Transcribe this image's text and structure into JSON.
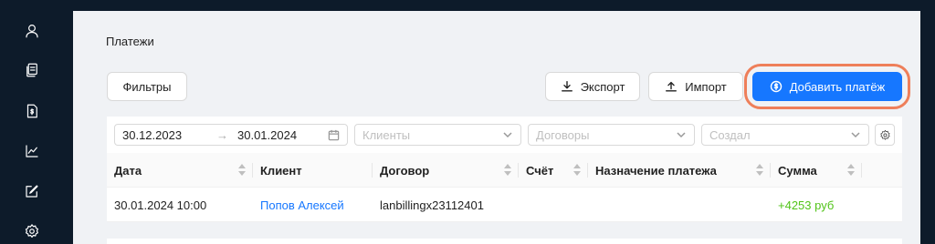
{
  "sidebar": {
    "icons": [
      "user-icon",
      "documents-icon",
      "document-dollar-icon",
      "chart-line-icon",
      "edit-square-icon",
      "settings-gear-icon"
    ]
  },
  "page": {
    "title": "Платежи"
  },
  "toolbar": {
    "filters_label": "Фильтры",
    "export_label": "Экспорт",
    "import_label": "Импорт",
    "add_payment_label": "Добавить платёж",
    "accent_color": "#1677ff",
    "highlight_color": "#ee7f5a"
  },
  "filters": {
    "date_from": "30.12.2023",
    "date_arrow": "→",
    "date_to": "30.01.2024",
    "clients_placeholder": "Клиенты",
    "contracts_placeholder": "Договоры",
    "created_placeholder": "Создал"
  },
  "table": {
    "columns": [
      "Дата",
      "Клиент",
      "Договор",
      "Счёт",
      "Назначение платежа",
      "Сумма"
    ],
    "rows": [
      {
        "date": "30.01.2024 10:00",
        "client": "Попов Алексей",
        "contract": "lanbillingx23112401",
        "invoice": "",
        "purpose": "",
        "amount": "+4253 руб"
      }
    ],
    "amount_color": "#52c41a"
  }
}
